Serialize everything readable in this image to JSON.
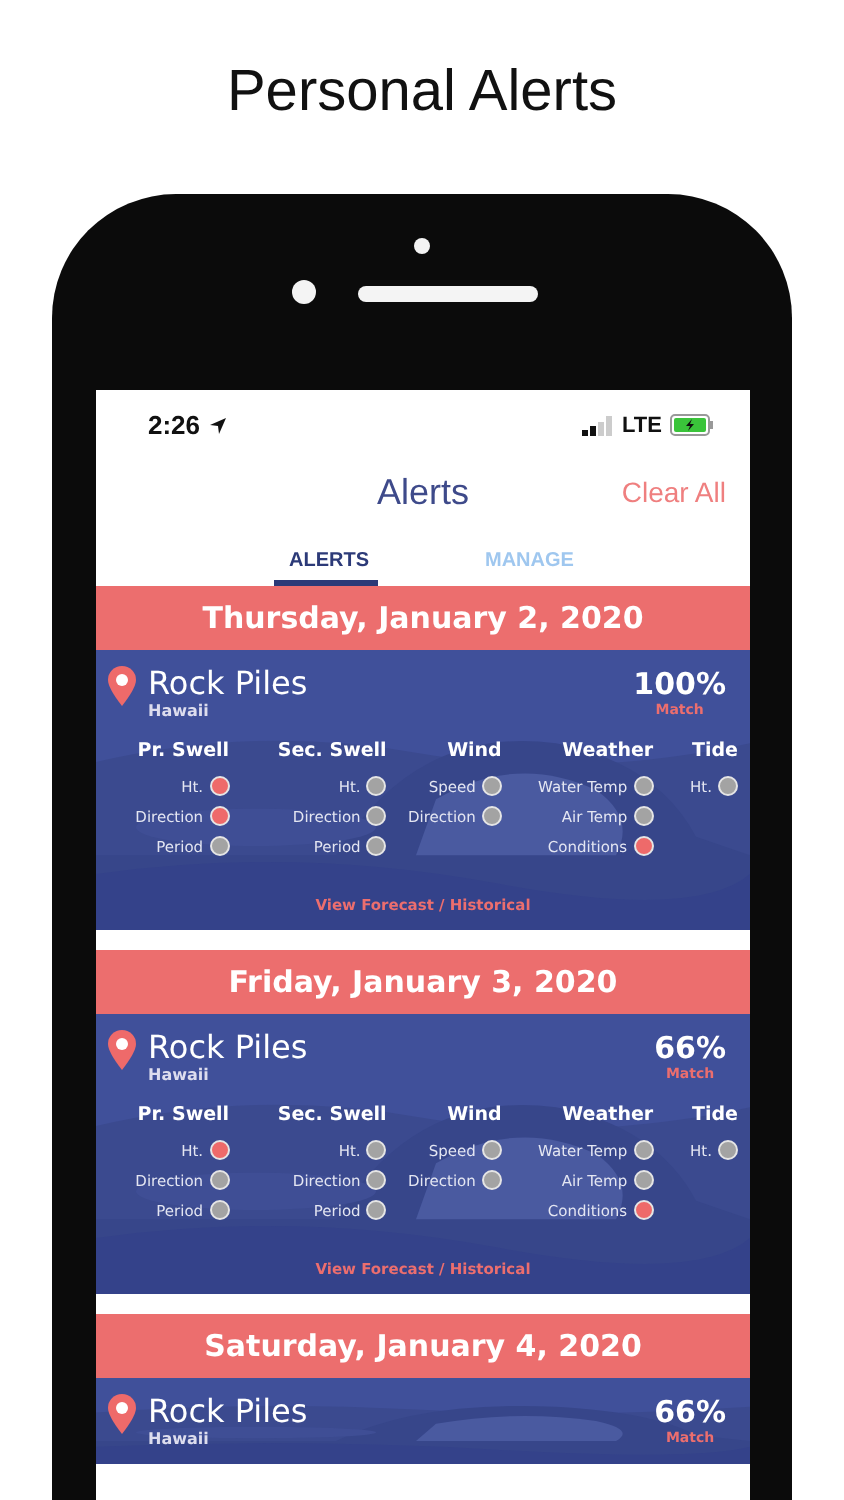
{
  "headline": "Personal Alerts",
  "status_bar": {
    "time": "2:26",
    "network": "LTE"
  },
  "nav": {
    "title": "Alerts",
    "action": "Clear All"
  },
  "tabs": [
    {
      "label": "ALERTS",
      "selected": true
    },
    {
      "label": "MANAGE",
      "selected": false
    }
  ],
  "alerts": [
    {
      "date": "Thursday, January 2, 2020",
      "spot": "Rock Piles",
      "region": "Hawaii",
      "match": "100%",
      "match_label": "Match",
      "link": "View Forecast / Historical",
      "columns": [
        {
          "title": "Pr. Swell",
          "items": [
            {
              "label": "Ht.",
              "on": true
            },
            {
              "label": "Direction",
              "on": true
            },
            {
              "label": "Period",
              "on": false
            }
          ]
        },
        {
          "title": "Sec. Swell",
          "items": [
            {
              "label": "Ht.",
              "on": false
            },
            {
              "label": "Direction",
              "on": false
            },
            {
              "label": "Period",
              "on": false
            }
          ]
        },
        {
          "title": "Wind",
          "items": [
            {
              "label": "Speed",
              "on": false
            },
            {
              "label": "Direction",
              "on": false
            }
          ]
        },
        {
          "title": "Weather",
          "items": [
            {
              "label": "Water Temp",
              "on": false
            },
            {
              "label": "Air Temp",
              "on": false
            },
            {
              "label": "Conditions",
              "on": true
            }
          ]
        },
        {
          "title": "Tide",
          "items": [
            {
              "label": "Ht.",
              "on": false
            }
          ]
        }
      ]
    },
    {
      "date": "Friday, January 3, 2020",
      "spot": "Rock Piles",
      "region": "Hawaii",
      "match": "66%",
      "match_label": "Match",
      "link": "View Forecast / Historical",
      "columns": [
        {
          "title": "Pr. Swell",
          "items": [
            {
              "label": "Ht.",
              "on": true
            },
            {
              "label": "Direction",
              "on": false
            },
            {
              "label": "Period",
              "on": false
            }
          ]
        },
        {
          "title": "Sec. Swell",
          "items": [
            {
              "label": "Ht.",
              "on": false
            },
            {
              "label": "Direction",
              "on": false
            },
            {
              "label": "Period",
              "on": false
            }
          ]
        },
        {
          "title": "Wind",
          "items": [
            {
              "label": "Speed",
              "on": false
            },
            {
              "label": "Direction",
              "on": false
            }
          ]
        },
        {
          "title": "Weather",
          "items": [
            {
              "label": "Water Temp",
              "on": false
            },
            {
              "label": "Air Temp",
              "on": false
            },
            {
              "label": "Conditions",
              "on": true
            }
          ]
        },
        {
          "title": "Tide",
          "items": [
            {
              "label": "Ht.",
              "on": false
            }
          ]
        }
      ]
    },
    {
      "date": "Saturday, January 4, 2020",
      "spot": "Rock Piles",
      "region": "Hawaii",
      "match": "66%",
      "match_label": "Match"
    }
  ]
}
